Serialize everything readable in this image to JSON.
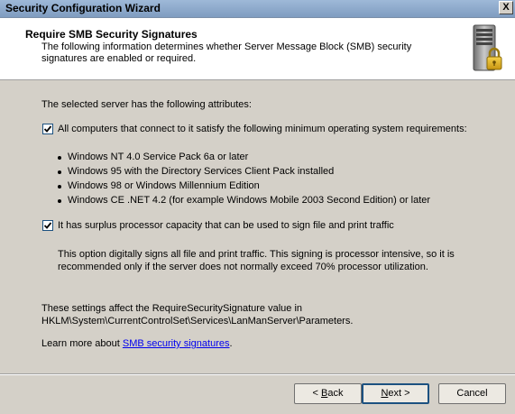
{
  "window": {
    "title": "Security Configuration Wizard",
    "close_glyph": "X"
  },
  "header": {
    "title": "Require SMB Security Signatures",
    "description": "The following information determines whether Server Message Block (SMB) security signatures are enabled or required.",
    "icon": "server-lock-icon"
  },
  "content": {
    "intro": "The selected server has the following attributes:",
    "option1": {
      "checked": true,
      "label": "All computers that connect to it satisfy the following minimum operating system requirements:"
    },
    "os_requirements": [
      "Windows NT 4.0 Service Pack 6a or later",
      "Windows 95 with the Directory Services Client Pack installed",
      "Windows 98 or Windows Millennium Edition",
      "Windows CE .NET 4.2 (for example Windows Mobile 2003 Second Edition) or later"
    ],
    "option2": {
      "checked": true,
      "label": "It has surplus processor capacity that can be used to sign file and print traffic"
    },
    "option2_note_line1": "This option digitally signs all file and print traffic. This signing is processor intensive, so it is",
    "option2_note_line2": "recommended only if the server does not normally exceed 70% processor utilization.",
    "settings_line1": "These settings affect the RequireSecuritySignature value in",
    "settings_line2": "HKLM\\System\\CurrentControlSet\\Services\\LanManServer\\Parameters.",
    "learn_prefix": "Learn more about ",
    "learn_link": "SMB security signatures",
    "learn_suffix": "."
  },
  "buttons": {
    "back_prefix": "< ",
    "back_key": "B",
    "back_rest": "ack",
    "next_key": "N",
    "next_rest": "ext >",
    "cancel": "Cancel"
  },
  "colors": {
    "dialog_bg": "#d4d0c8",
    "header_bg": "#ffffff",
    "link": "#0000ee",
    "checkbox_border": "#1c5180"
  }
}
